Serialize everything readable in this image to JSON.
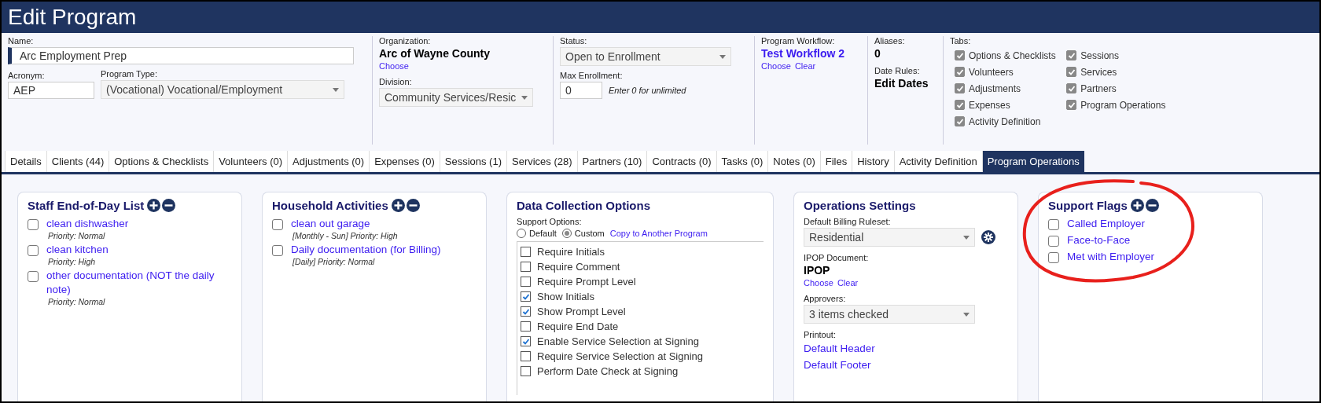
{
  "window": {
    "title": "Edit Program"
  },
  "header": {
    "name": {
      "label": "Name:",
      "value": "Arc Employment Prep"
    },
    "acronym": {
      "label": "Acronym:",
      "value": "AEP"
    },
    "program_type": {
      "label": "Program Type:",
      "value": "(Vocational) Vocational/Employment"
    },
    "organization": {
      "label": "Organization:",
      "value": "Arc of Wayne County",
      "links": [
        "Choose"
      ]
    },
    "division": {
      "label": "Division:",
      "value": "Community Services/Resic"
    },
    "status": {
      "label": "Status:",
      "value": "Open to Enrollment"
    },
    "max_enrollment": {
      "label": "Max Enrollment:",
      "value": "0",
      "hint": "Enter 0 for unlimited"
    },
    "program_workflow": {
      "label": "Program Workflow:",
      "value": "Test Workflow 2",
      "links": [
        "Choose",
        "Clear"
      ]
    },
    "aliases": {
      "label": "Aliases:",
      "value": "0"
    },
    "date_rules": {
      "label": "Date Rules:",
      "value": "Edit Dates"
    },
    "tab_settings": {
      "label": "Tabs:",
      "items": [
        {
          "label": "Options & Checklists",
          "checked": true
        },
        {
          "label": "Volunteers",
          "checked": true
        },
        {
          "label": "Adjustments",
          "checked": true
        },
        {
          "label": "Expenses",
          "checked": true
        },
        {
          "label": "Activity Definition",
          "checked": true
        },
        {
          "label": "Sessions",
          "checked": true
        },
        {
          "label": "Services",
          "checked": true
        },
        {
          "label": "Partners",
          "checked": true
        },
        {
          "label": "Program Operations",
          "checked": true
        }
      ]
    }
  },
  "tabs": [
    {
      "label": "Details",
      "selected": false
    },
    {
      "label": "Clients (44)",
      "selected": false
    },
    {
      "label": "Options & Checklists",
      "selected": false
    },
    {
      "label": "Volunteers (0)",
      "selected": false
    },
    {
      "label": "Adjustments (0)",
      "selected": false
    },
    {
      "label": "Expenses (0)",
      "selected": false
    },
    {
      "label": "Sessions (1)",
      "selected": false
    },
    {
      "label": "Services (28)",
      "selected": false
    },
    {
      "label": "Partners (10)",
      "selected": false
    },
    {
      "label": "Contracts (0)",
      "selected": false
    },
    {
      "label": "Tasks (0)",
      "selected": false
    },
    {
      "label": "Notes (0)",
      "selected": false
    },
    {
      "label": "Files",
      "selected": false
    },
    {
      "label": "History",
      "selected": false
    },
    {
      "label": "Activity Definition",
      "selected": false
    },
    {
      "label": "Program Operations",
      "selected": true
    }
  ],
  "panels": [
    {
      "kind": "checklist",
      "title": "Staff End-of-Day List",
      "items": [
        {
          "label": "clean dishwasher",
          "detail": "Priority: Normal",
          "checked": false
        },
        {
          "label": "clean kitchen",
          "detail": "Priority: High",
          "checked": false
        },
        {
          "label": "other documentation (NOT the daily note)",
          "detail": "Priority: Normal",
          "checked": false
        }
      ]
    },
    {
      "kind": "checklist",
      "title": "Household Activities",
      "items": [
        {
          "label": "clean out garage",
          "detail": "[Monthly - Sun] Priority: High",
          "checked": false
        },
        {
          "label": "Daily documentation (for Billing)",
          "detail": "[Daily] Priority: Normal",
          "checked": false
        }
      ]
    },
    {
      "kind": "options",
      "title": "Data Collection Options",
      "label": "Support Options:",
      "radios": [
        {
          "label": "Default",
          "selected": false
        },
        {
          "label": "Custom",
          "selected": true
        }
      ],
      "link": "Copy to Another Program",
      "items": [
        {
          "label": "Require Initials",
          "checked": false
        },
        {
          "label": "Require Comment",
          "checked": false
        },
        {
          "label": "Require Prompt Level",
          "checked": false
        },
        {
          "label": "Show Initials",
          "checked": true
        },
        {
          "label": "Show Prompt Level",
          "checked": true
        },
        {
          "label": "Require End Date",
          "checked": false
        },
        {
          "label": "Enable Service Selection at Signing",
          "checked": true
        },
        {
          "label": "Require Service Selection at Signing",
          "checked": false
        },
        {
          "label": "Perform Date Check at Signing",
          "checked": false
        }
      ]
    },
    {
      "kind": "settings",
      "title": "Operations Settings",
      "billing": {
        "label": "Default Billing Ruleset:",
        "value": "Residential"
      },
      "ipop": {
        "label": "IPOP Document:",
        "value": "IPOP",
        "links": [
          "Choose",
          "Clear"
        ]
      },
      "approvers": {
        "label": "Approvers:",
        "value": "3 items checked"
      },
      "printout": {
        "label": "Printout:",
        "links": [
          "Default Header",
          "Default Footer"
        ]
      }
    },
    {
      "kind": "checklist",
      "title": "Support Flags",
      "circled": true,
      "items": [
        {
          "label": "Called Employer",
          "checked": false
        },
        {
          "label": "Face-to-Face",
          "checked": false
        },
        {
          "label": "Met with Employer",
          "checked": false
        }
      ]
    }
  ]
}
